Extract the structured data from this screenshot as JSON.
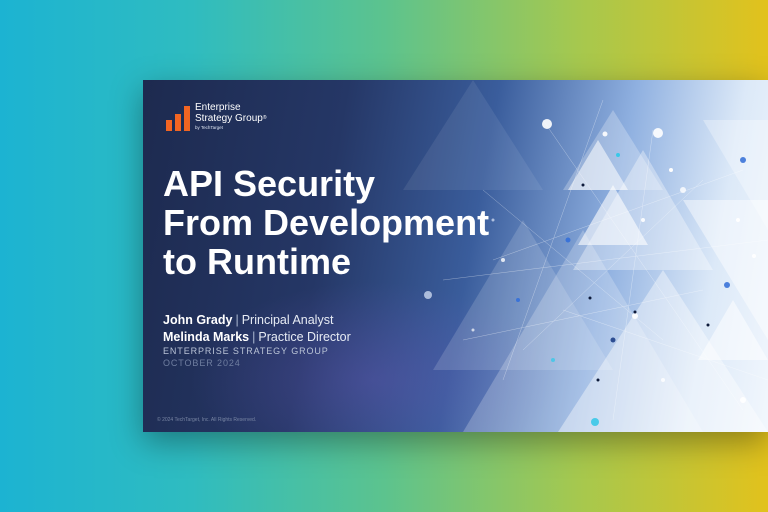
{
  "colors": {
    "background_left": "#1cb3d2",
    "background_right": "#e2c21c",
    "slide_dark": "#1d2a4f",
    "logo_orange": "#f26522"
  },
  "logo": {
    "icon": "bar-chart-logo-icon",
    "line1": "Enterprise",
    "line2": "Strategy Group",
    "registered": "®",
    "byline": "by TechTarget"
  },
  "title": {
    "line1": "API Security",
    "line2": "From Development",
    "line3": "to Runtime"
  },
  "authors": [
    {
      "name": "John Grady",
      "separator": "|",
      "role": "Principal Analyst"
    },
    {
      "name": "Melinda Marks",
      "separator": "|",
      "role": "Practice Director"
    }
  ],
  "organization": "ENTERPRISE STRATEGY GROUP",
  "date": "OCTOBER 2024",
  "copyright": "© 2024 TechTarget, Inc. All Rights Reserved."
}
